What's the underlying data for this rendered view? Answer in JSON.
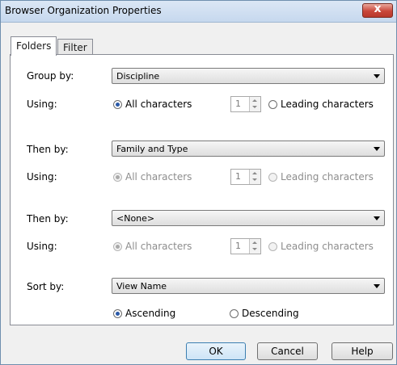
{
  "window": {
    "title": "Browser Organization Properties",
    "close_label": "x"
  },
  "tabs": [
    {
      "label": "Folders",
      "active": true
    },
    {
      "label": "Filter",
      "active": false
    }
  ],
  "groups": [
    {
      "by_label": "Group by:",
      "value": "Discipline",
      "enabled": true,
      "using_label": "Using:",
      "all_chars_label": "All characters",
      "count": "1",
      "leading_chars_label": "Leading characters"
    },
    {
      "by_label": "Then by:",
      "value": "Family and Type",
      "enabled": false,
      "using_label": "Using:",
      "all_chars_label": "All characters",
      "count": "1",
      "leading_chars_label": "Leading characters"
    },
    {
      "by_label": "Then by:",
      "value": "<None>",
      "enabled": false,
      "using_label": "Using:",
      "all_chars_label": "All characters",
      "count": "1",
      "leading_chars_label": "Leading characters"
    }
  ],
  "sort": {
    "label": "Sort by:",
    "value": "View Name",
    "ascending_label": "Ascending",
    "descending_label": "Descending",
    "selected": "Ascending"
  },
  "buttons": {
    "ok": "OK",
    "cancel": "Cancel",
    "help": "Help"
  }
}
